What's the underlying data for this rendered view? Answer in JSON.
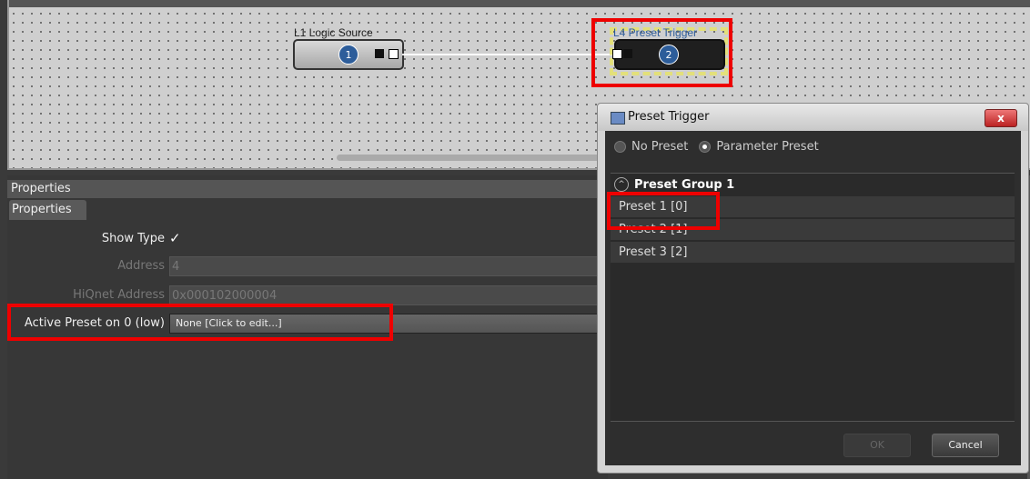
{
  "canvas": {
    "logic_source": {
      "title": "L1  Logic Source",
      "badge": "1"
    },
    "preset_trigger_block": {
      "title": "L4  Preset Trigger",
      "badge": "2"
    }
  },
  "properties": {
    "header": "Properties",
    "tab": "Properties",
    "rows": [
      {
        "label": "Show Type",
        "value": "✓"
      },
      {
        "label": "Address",
        "value": "4"
      },
      {
        "label": "HiQnet Address",
        "value": "0x000102000004"
      },
      {
        "label": "Active Preset on 0 (low)",
        "value": "None [Click to edit...]"
      }
    ]
  },
  "dialog": {
    "title": "Preset Trigger",
    "close_label": "x",
    "radio_no_preset": "No Preset",
    "radio_parameter_preset": "Parameter Preset",
    "group_label": "Preset Group 1",
    "presets": [
      "Preset 1 [0]",
      "Preset 2 [1]",
      "Preset 3 [2]"
    ],
    "ok_label": "OK",
    "cancel_label": "Cancel"
  },
  "colors": {
    "highlight": "#e00000",
    "selection": "#e3e07a",
    "badge": "#2d5d9a"
  }
}
